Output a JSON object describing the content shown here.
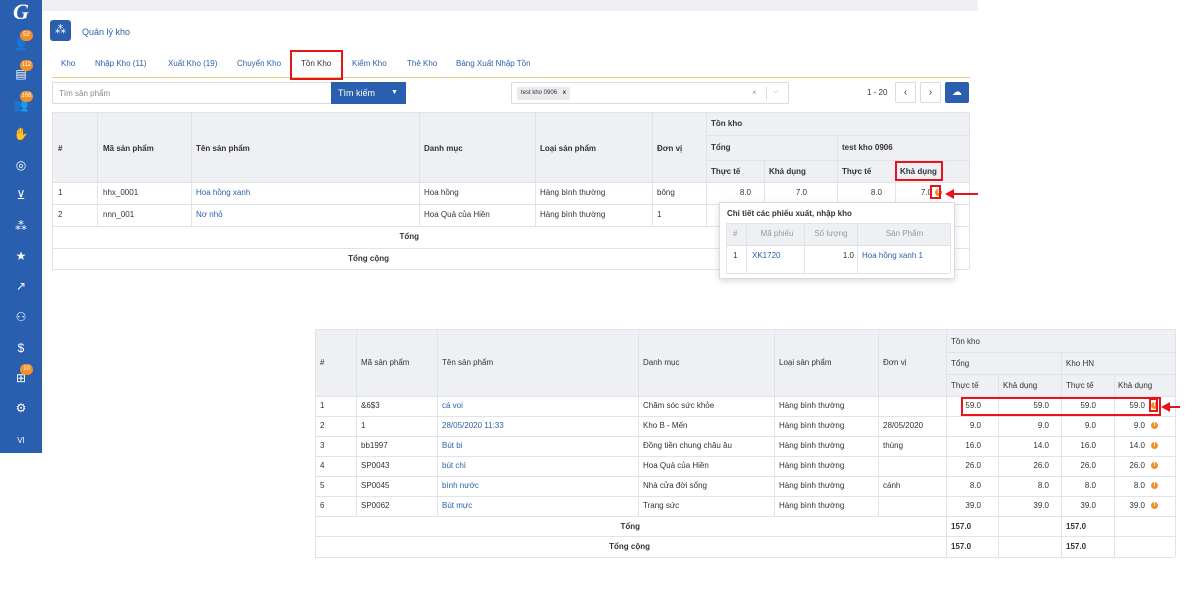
{
  "sidebar": {
    "logo": "G",
    "items": [
      {
        "icon": "user-icon",
        "glyph": "👤",
        "badge": "52"
      },
      {
        "icon": "cart-list-icon",
        "glyph": "▤",
        "badge": "112"
      },
      {
        "icon": "person-list-icon",
        "glyph": "👥",
        "badge": "166"
      },
      {
        "icon": "handshake-icon",
        "glyph": "✋",
        "badge": ""
      },
      {
        "icon": "target-icon",
        "glyph": "◎",
        "badge": ""
      },
      {
        "icon": "shopping-cart-icon",
        "glyph": "⊻",
        "badge": ""
      },
      {
        "icon": "cubes-icon",
        "glyph": "⁂",
        "badge": ""
      },
      {
        "icon": "star-icon",
        "glyph": "★",
        "badge": ""
      },
      {
        "icon": "chart-line-icon",
        "glyph": "↗",
        "badge": ""
      },
      {
        "icon": "users-icon",
        "glyph": "⚇",
        "badge": ""
      },
      {
        "icon": "dollar-icon",
        "glyph": "$",
        "badge": ""
      },
      {
        "icon": "sitemap-icon",
        "glyph": "⊞",
        "badge": "10"
      },
      {
        "icon": "gear-icon",
        "glyph": "⚙",
        "badge": ""
      }
    ],
    "lang": "VI"
  },
  "module": {
    "title": "Quản lý kho"
  },
  "tabs": [
    {
      "label": "Kho"
    },
    {
      "label": "Nhập Kho (11)"
    },
    {
      "label": "Xuất Kho (19)"
    },
    {
      "label": "Chuyển Kho"
    },
    {
      "label": "Tồn Kho",
      "active": true
    },
    {
      "label": "Kiểm Kho"
    },
    {
      "label": "Thẻ Kho"
    },
    {
      "label": "Bảng Xuất Nhập Tồn"
    }
  ],
  "search": {
    "placeholder": "Tìm sản phẩm",
    "button": "Tìm kiếm"
  },
  "filter": {
    "chip": "test kho 0906",
    "chip_x": "x",
    "clear": "×",
    "arrow": "⌵"
  },
  "pager": {
    "range": "1 - 20",
    "prev": "‹",
    "next": "›"
  },
  "table1": {
    "headers": {
      "idx": "#",
      "code": "Mã sản phẩm",
      "name": "Tên sản phẩm",
      "category": "Danh mục",
      "type": "Loại sản phẩm",
      "unit": "Đơn vị",
      "stock": "Tồn kho",
      "total": "Tổng",
      "wh": "test kho 0906",
      "actual": "Thực tế",
      "avail": "Khả dụng"
    },
    "rows": [
      {
        "idx": "1",
        "code": "hhx_0001",
        "name": "Hoa hồng xanh",
        "category": "Hoa hồng",
        "type": "Hàng bình thường",
        "unit": "bông",
        "t_actual": "8.0",
        "t_avail": "7.0",
        "w_actual": "8.0",
        "w_avail": "7.0"
      },
      {
        "idx": "2",
        "code": "nnn_001",
        "name": "Nơ nhỏ",
        "category": "Hoa Quả của Hiền",
        "type": "Hàng bình thường",
        "unit": "1",
        "t_actual": "",
        "t_avail": "",
        "w_actual": "",
        "w_avail": ""
      }
    ],
    "sum_label": "Tổng",
    "grand_label": "Tổng cộng"
  },
  "popup": {
    "title": "Chi tiết các phiếu xuất, nhập kho",
    "headers": {
      "idx": "#",
      "code": "Mã phiếu",
      "qty": "Số lượng",
      "product": "Sản Phẩm"
    },
    "rows": [
      {
        "idx": "1",
        "code": "XK1720",
        "qty": "1.0",
        "product": "Hoa hồng xanh 1"
      }
    ]
  },
  "table2": {
    "headers": {
      "idx": "#",
      "code": "Mã sản phẩm",
      "name": "Tên sản phẩm",
      "category": "Danh mục",
      "type": "Loại sản phẩm",
      "unit": "Đơn vị",
      "stock": "Tồn kho",
      "total": "Tổng",
      "wh": "Kho HN",
      "actual": "Thực tế",
      "avail": "Khả dụng"
    },
    "rows": [
      {
        "idx": "1",
        "code": "&6$3",
        "name": "cá voi",
        "category": "Chăm sóc sức khỏe",
        "type": "Hàng bình thường",
        "unit": "",
        "t_actual": "59.0",
        "t_avail": "59.0",
        "w_actual": "59.0",
        "w_avail": "59.0"
      },
      {
        "idx": "2",
        "code": "1",
        "name": "28/05/2020 11:33",
        "category": "Kho B - Mến",
        "type": "Hàng bình thường",
        "unit": "28/05/2020",
        "t_actual": "9.0",
        "t_avail": "9.0",
        "w_actual": "9.0",
        "w_avail": "9.0"
      },
      {
        "idx": "3",
        "code": "bb1997",
        "name": "Bút bi",
        "category": "Đồng tiền chung châu âu",
        "type": "Hàng bình thường",
        "unit": "thùng",
        "t_actual": "16.0",
        "t_avail": "14.0",
        "w_actual": "16.0",
        "w_avail": "14.0"
      },
      {
        "idx": "4",
        "code": "SP0043",
        "name": "bút chì",
        "category": "Hoa Quả của Hiền",
        "type": "Hàng bình thường",
        "unit": "",
        "t_actual": "26.0",
        "t_avail": "26.0",
        "w_actual": "26.0",
        "w_avail": "26.0"
      },
      {
        "idx": "5",
        "code": "SP0045",
        "name": "bình nước",
        "category": "Nhà cửa đời sống",
        "type": "Hàng bình thường",
        "unit": "cánh",
        "t_actual": "8.0",
        "t_avail": "8.0",
        "w_actual": "8.0",
        "w_avail": "8.0"
      },
      {
        "idx": "6",
        "code": "SP0062",
        "name": "Bút mực",
        "category": "Trang sức",
        "type": "Hàng bình thường",
        "unit": "",
        "t_actual": "39.0",
        "t_avail": "39.0",
        "w_actual": "39.0",
        "w_avail": "39.0"
      }
    ],
    "sum_label": "Tổng",
    "sum_total": "157.0",
    "sum_wh": "157.0",
    "grand_label": "Tổng cộng",
    "grand_total": "157.0",
    "grand_wh": "157.0"
  },
  "info_glyph": "i"
}
